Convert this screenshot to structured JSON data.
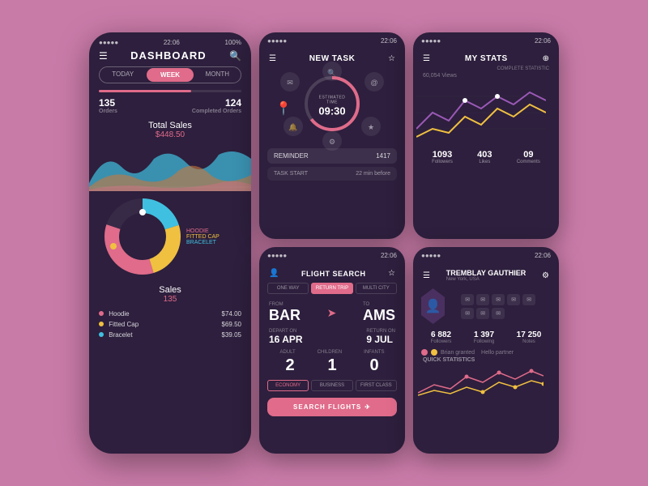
{
  "dashboard": {
    "status_time": "22:06",
    "status_battery": "100%",
    "title": "DASHBOARD",
    "tabs": [
      "TODAY",
      "WEEK",
      "MONTH"
    ],
    "active_tab": "WEEK",
    "orders_label": "Orders",
    "orders_value": "135",
    "completed_label": "Completed Orders",
    "completed_value": "124",
    "total_sales_label": "Total Sales",
    "total_sales_value": "$448.50",
    "sales_label": "Sales",
    "sales_value": "135",
    "legend": [
      {
        "name": "Hoodie",
        "color": "#e06b8a",
        "price": "$74.00"
      },
      {
        "name": "Fitted Cap",
        "color": "#f0c040",
        "price": "$69.50"
      },
      {
        "name": "Bracelet",
        "color": "#40c0e0",
        "price": "$39.05"
      }
    ],
    "donut_labels": [
      "HOODIE",
      "FITTED CAP",
      "BRACELET"
    ]
  },
  "newtask": {
    "title": "NEW TASK",
    "timer_label": "ESTIMATED TIME",
    "timer_value": "09:30",
    "reminder_label": "REMINDER",
    "reminder_value": "1417",
    "task_start_label": "TASK START",
    "task_start_value": "22 min before"
  },
  "mystats": {
    "title": "MY STATS",
    "subtitle": "COMPLETE STATISTIC",
    "views": "60,054 Views",
    "followers_label": "Followers",
    "followers_value": "1093",
    "likes_label": "Likes",
    "likes_value": "403",
    "comments_label": "Comments",
    "comments_value": "09"
  },
  "flightsearch": {
    "title": "FLIGHT SEARCH",
    "trip_tabs": [
      "ONE WAY",
      "RETURN TRIP",
      "MULTI CITY"
    ],
    "active_trip": "RETURN TRIP",
    "from_label": "FROM",
    "from_code": "BAR",
    "to_label": "TO",
    "to_code": "AMS",
    "depart_label": "DEPART ON",
    "depart_value": "16 APR",
    "return_label": "RETURN ON",
    "return_value": "9 JUL",
    "pass_labels": [
      "ADULT",
      "CHILDREN",
      "INFANTS"
    ],
    "pass_values": [
      "2",
      "1",
      "0"
    ],
    "class_tabs": [
      "ECONOMY",
      "BUSINESS",
      "FIRST CLASS"
    ],
    "active_class": "ECONOMY",
    "search_btn": "SEARCH FLIGHTS"
  },
  "profile": {
    "title": "TREMBLAY GAUTHIER",
    "location": "New York, USA",
    "followers_label": "Followers",
    "followers_value": "6 882",
    "following_label": "Following",
    "following_value": "1 397",
    "notes_label": "Notes",
    "notes_value": "17 250",
    "quick_stats_label": "QUICK STATISTICS",
    "person1": "Brian granted",
    "person2": "Hello partner",
    "icons": [
      "✉",
      "✉",
      "✉",
      "✉",
      "✉",
      "✉",
      "✉",
      "✉"
    ]
  }
}
